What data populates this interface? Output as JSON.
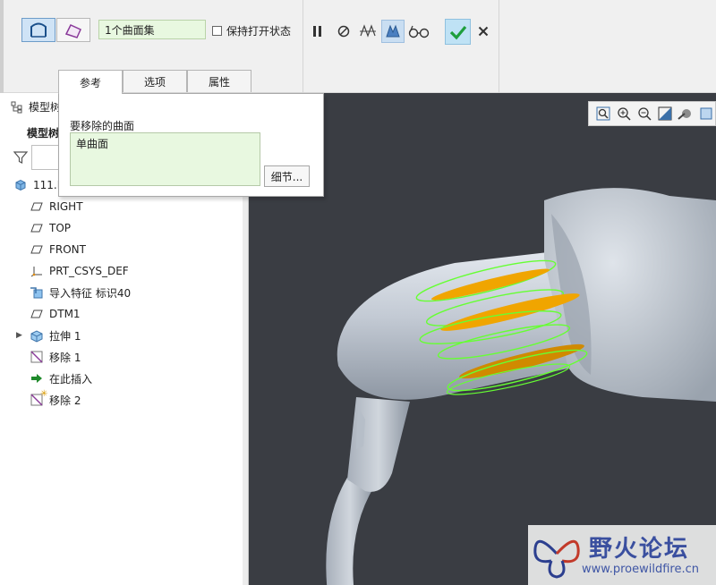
{
  "dashboard": {
    "collector_value": "1个曲面集",
    "keep_open_label": "保持打开状态"
  },
  "tabs": [
    {
      "label": "参考",
      "active": true
    },
    {
      "label": "选项",
      "active": false
    },
    {
      "label": "属性",
      "active": false
    }
  ],
  "ref_panel": {
    "label": "要移除的曲面",
    "item": "单曲面",
    "details_label": "细节..."
  },
  "tree": {
    "header": "模型树",
    "sub_header": "模型树",
    "items": [
      {
        "label": "111.PRT",
        "icon": "part-icon"
      },
      {
        "label": "RIGHT",
        "icon": "datum-plane-icon"
      },
      {
        "label": "TOP",
        "icon": "datum-plane-icon"
      },
      {
        "label": "FRONT",
        "icon": "datum-plane-icon"
      },
      {
        "label": "PRT_CSYS_DEF",
        "icon": "csys-icon"
      },
      {
        "label": "导入特征 标识40",
        "icon": "import-feature-icon"
      },
      {
        "label": "DTM1",
        "icon": "datum-plane-icon"
      },
      {
        "label": "拉伸 1",
        "icon": "extrude-icon"
      },
      {
        "label": "移除 1",
        "icon": "remove-icon"
      },
      {
        "label": "在此插入",
        "icon": "insert-here-icon"
      },
      {
        "label": "移除 2",
        "icon": "remove-icon"
      }
    ]
  },
  "watermark": {
    "title": "野火论坛",
    "url": "www.proewildfire.cn"
  },
  "colors": {
    "accent_blue": "#cfe3f6",
    "collector_green": "#e8f8e0",
    "viewport_bg": "#3a3d43",
    "highlight_green": "#66ff33",
    "highlight_orange": "#f0a500",
    "model_gray": "#c5ccd6",
    "ok_green": "#1e9e3c"
  }
}
